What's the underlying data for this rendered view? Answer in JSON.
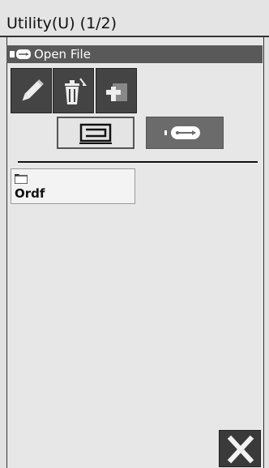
{
  "window": {
    "title": "Utility(U) (1/2)"
  },
  "section": {
    "label": "Open File",
    "icon": "usb-icon"
  },
  "toolbar": {
    "edit_icon": "pencil-icon",
    "delete_icon": "trash-icon",
    "add_icon": "add-folder-icon"
  },
  "source": {
    "machine_icon": "sewing-machine-icon",
    "usb_icon": "usb-icon",
    "selected": "usb"
  },
  "files": [
    {
      "type": "folder",
      "name": "Ordf"
    }
  ],
  "footer": {
    "close_icon": "close-icon"
  }
}
